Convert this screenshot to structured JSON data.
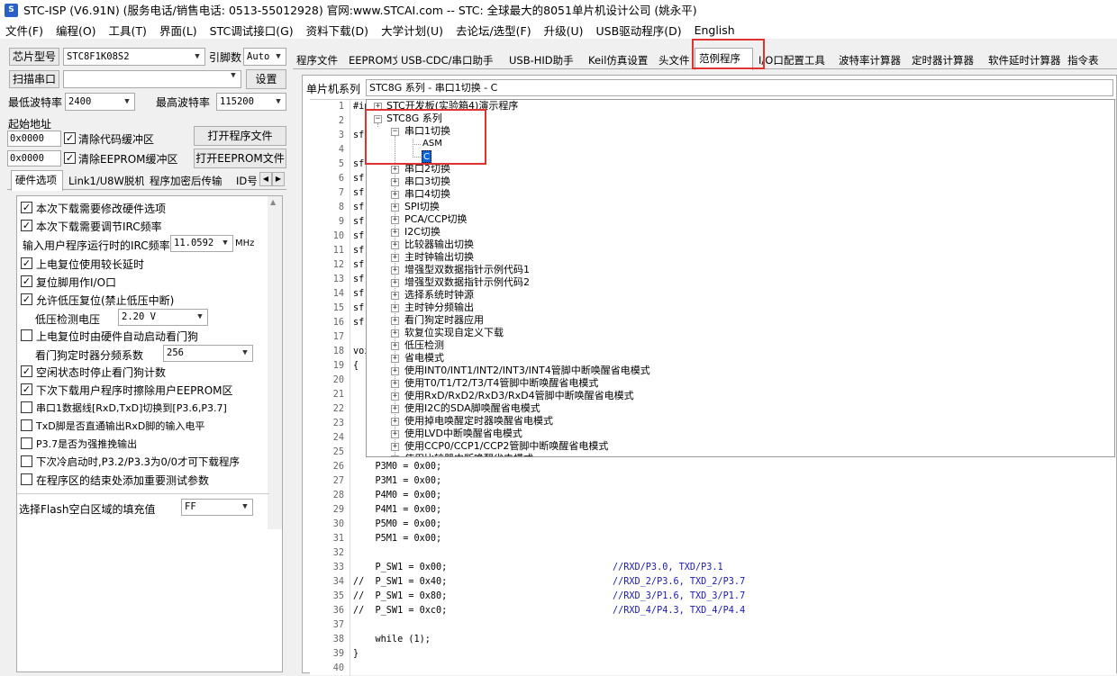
{
  "title": "STC-ISP (V6.91N) (服务电话/销售电话: 0513-55012928) 官网:www.STCAI.com  -- STC: 全球最大的8051单片机设计公司 (姚永平)",
  "menu": [
    "文件(F)",
    "编程(O)",
    "工具(T)",
    "界面(L)",
    "STC调试接口(G)",
    "资料下载(D)",
    "大学计划(U)",
    "去论坛/选型(F)",
    "升级(U)",
    "USB驱动程序(D)",
    "English"
  ],
  "left": {
    "chip_btn": "芯片型号",
    "chip_value": "STC8F1K08S2",
    "pin_label": "引脚数",
    "pin_value": "Auto",
    "scan_btn": "扫描串口",
    "settings_btn": "设置",
    "min_baud_label": "最低波特率",
    "min_baud": "2400",
    "max_baud_label": "最高波特率",
    "max_baud": "115200",
    "start_addr_label": "起始地址",
    "addr1": "0x0000",
    "clear_code": "清除代码缓冲区",
    "open_prog": "打开程序文件",
    "addr2": "0x0000",
    "clear_eeprom": "清除EEPROM缓冲区",
    "open_eeprom": "打开EEPROM文件",
    "tabs": [
      "硬件选项",
      "Link1/U8W脱机",
      "程序加密后传输",
      "ID号"
    ],
    "options": [
      {
        "label": "本次下载需要修改硬件选项",
        "checked": true
      },
      {
        "label": "本次下载需要调节IRC频率",
        "checked": true
      },
      {
        "label": "上电复位使用较长延时",
        "checked": true
      },
      {
        "label": "复位脚用作I/O口",
        "checked": true
      },
      {
        "label": "允许低压复位(禁止低压中断)",
        "checked": true
      },
      {
        "label": "上电复位时由硬件自动启动看门狗",
        "checked": false
      },
      {
        "label": "空闲状态时停止看门狗计数",
        "checked": true
      },
      {
        "label": "下次下载用户程序时擦除用户EEPROM区",
        "checked": true
      },
      {
        "label": "串口1数据线[RxD,TxD]切换到[P3.6,P3.7]",
        "checked": false
      },
      {
        "label": "TxD脚是否直通输出RxD脚的输入电平",
        "checked": false
      },
      {
        "label": "P3.7是否为强推挽输出",
        "checked": false
      },
      {
        "label": "下次冷启动时,P3.2/P3.3为0/0才可下载程序",
        "checked": false
      },
      {
        "label": "在程序区的结束处添加重要测试参数",
        "checked": false
      }
    ],
    "irc_label": "输入用户程序运行时的IRC频率",
    "irc_value": "11.0592",
    "irc_unit": "MHz",
    "lv_label": "低压检测电压",
    "lv_value": "2.20 V",
    "wdt_label": "看门狗定时器分频系数",
    "wdt_value": "256",
    "flash_label": "选择Flash空白区域的填充值",
    "flash_value": "FF"
  },
  "top_tabs": [
    "程序文件",
    "EEPROM文件",
    "USB-CDC/串口助手",
    "USB-HID助手",
    "Keil仿真设置",
    "头文件",
    "范例程序",
    "I/O口配置工具",
    "波特率计算器",
    "定时器计算器",
    "软件延时计算器",
    "指令表"
  ],
  "series_label": "单片机系列",
  "series_value": "STC8G 系列 - 串口1切换 - C",
  "code_lines": [
    {
      "n": "1",
      "t": "#inc"
    },
    {
      "n": "2",
      "t": ""
    },
    {
      "n": "3",
      "t": "sfr"
    },
    {
      "n": "4",
      "t": ""
    },
    {
      "n": "5",
      "t": "sfr"
    },
    {
      "n": "6",
      "t": "sfr"
    },
    {
      "n": "7",
      "t": "sfr"
    },
    {
      "n": "8",
      "t": "sfr"
    },
    {
      "n": "9",
      "t": "sfr"
    },
    {
      "n": "10",
      "t": "sfr"
    },
    {
      "n": "11",
      "t": "sfr"
    },
    {
      "n": "12",
      "t": "sfr"
    },
    {
      "n": "13",
      "t": "sfr"
    },
    {
      "n": "14",
      "t": "sfr"
    },
    {
      "n": "15",
      "t": "sfr"
    },
    {
      "n": "16",
      "t": "sfr"
    },
    {
      "n": "17",
      "t": ""
    },
    {
      "n": "18",
      "t": "void"
    },
    {
      "n": "19",
      "t": "{"
    },
    {
      "n": "20",
      "t": ""
    },
    {
      "n": "21",
      "t": ""
    },
    {
      "n": "22",
      "t": ""
    },
    {
      "n": "23",
      "t": ""
    },
    {
      "n": "24",
      "t": ""
    },
    {
      "n": "25",
      "t": ""
    },
    {
      "n": "26",
      "t": "    P3M0 = 0x00;"
    },
    {
      "n": "27",
      "t": "    P3M1 = 0x00;"
    },
    {
      "n": "28",
      "t": "    P4M0 = 0x00;"
    },
    {
      "n": "29",
      "t": "    P4M1 = 0x00;"
    },
    {
      "n": "30",
      "t": "    P5M0 = 0x00;"
    },
    {
      "n": "31",
      "t": "    P5M1 = 0x00;"
    },
    {
      "n": "32",
      "t": ""
    },
    {
      "n": "33",
      "t": "    P_SW1 = 0x00;",
      "c": "//RXD/P3.0, TXD/P3.1"
    },
    {
      "n": "34",
      "t": "//  P_SW1 = 0x40;",
      "c": "//RXD_2/P3.6, TXD_2/P3.7"
    },
    {
      "n": "35",
      "t": "//  P_SW1 = 0x80;",
      "c": "//RXD_3/P1.6, TXD_3/P1.7"
    },
    {
      "n": "36",
      "t": "//  P_SW1 = 0xc0;",
      "c": "//RXD_4/P4.3, TXD_4/P4.4"
    },
    {
      "n": "37",
      "t": ""
    },
    {
      "n": "38",
      "t": "    while (1);"
    },
    {
      "n": "39",
      "t": "}"
    },
    {
      "n": "40",
      "t": ""
    }
  ],
  "tree": {
    "root_dev": "STC开发板(实验箱4)演示程序",
    "series": "STC8G 系列",
    "uart1": "串口1切换",
    "asm": "ASM",
    "c": "C",
    "items": [
      "串口2切换",
      "串口3切换",
      "串口4切换",
      "SPI切换",
      "PCA/CCP切换",
      "I2C切换",
      "比较器输出切换",
      "主时钟输出切换",
      "增强型双数据指针示例代码1",
      "增强型双数据指针示例代码2",
      "选择系统时钟源",
      "主时钟分频输出",
      "看门狗定时器应用",
      "软复位实现自定义下载",
      "低压检测",
      "省电模式",
      "使用INT0/INT1/INT2/INT3/INT4管脚中断唤醒省电模式",
      "使用T0/T1/T2/T3/T4管脚中断唤醒省电模式",
      "使用RxD/RxD2/RxD3/RxD4管脚中断唤醒省电模式",
      "使用I2C的SDA脚唤醒省电模式",
      "使用掉电唤醒定时器唤醒省电模式",
      "使用LVD中断唤醒省电模式",
      "使用CCP0/CCP1/CCP2管脚中断唤醒省电模式",
      "使用比较器中断唤醒省电模式"
    ]
  },
  "colors": {
    "highlight": "#e0322e",
    "selection": "#0a64d6"
  }
}
